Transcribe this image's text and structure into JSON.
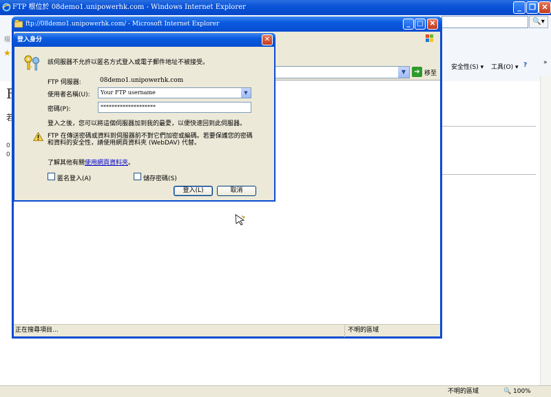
{
  "outer_window": {
    "title": "FTP 根位於 08demo1.unipowerhk.com - Windows Internet Explorer",
    "menu_hint": "檔",
    "toolbar": {
      "safety": "安全性(S) ▾",
      "tools": "工具(O) ▾",
      "help": "?",
      "more": "»"
    },
    "page_heading_fragment": "F",
    "page_text_fragment": "若",
    "page_list_fragments": [
      "0",
      "0"
    ],
    "status": {
      "zone": "不明的區域",
      "zoom": "100%"
    }
  },
  "inner_window": {
    "title": "ftp://08demo1.unipowerhk.com/ - Microsoft Internet Explorer",
    "go_label": "移至",
    "status_text": "正在搜尋項目...",
    "zone_text": "不明的區域"
  },
  "dialog": {
    "title": "登入身分",
    "message": "該伺服器不允許以匿名方式登入或電子郵件地址不被接受。",
    "server_label": "FTP 伺服器:",
    "server_value": "08demo1.unipowerhk.com",
    "username_label": "使用者名稱(U):",
    "username_value": "Your FTP username",
    "password_label": "密碼(P):",
    "password_value": "********************",
    "favorites_note": "登入之後，您可以將這個伺服器加到我的最愛，以便快速回到此伺服器。",
    "warning_line1": "FTP 在傳送密碼或資料到伺服器前不對它們加密或編碼。若要保護您的密碼",
    "warning_line2": "和資料的安全性，請使用網頁資料夾 (WebDAV) 代替。",
    "learn_more_prefix": "了解其他有關",
    "learn_more_link": "使用網頁資料夾",
    "learn_more_suffix": "。",
    "anonymous_label": "匿名登入(A)",
    "anonymous_checked": false,
    "save_password_label": "儲存密碼(S)",
    "save_password_checked": false,
    "login_button": "登入(L)",
    "cancel_button": "取消"
  }
}
